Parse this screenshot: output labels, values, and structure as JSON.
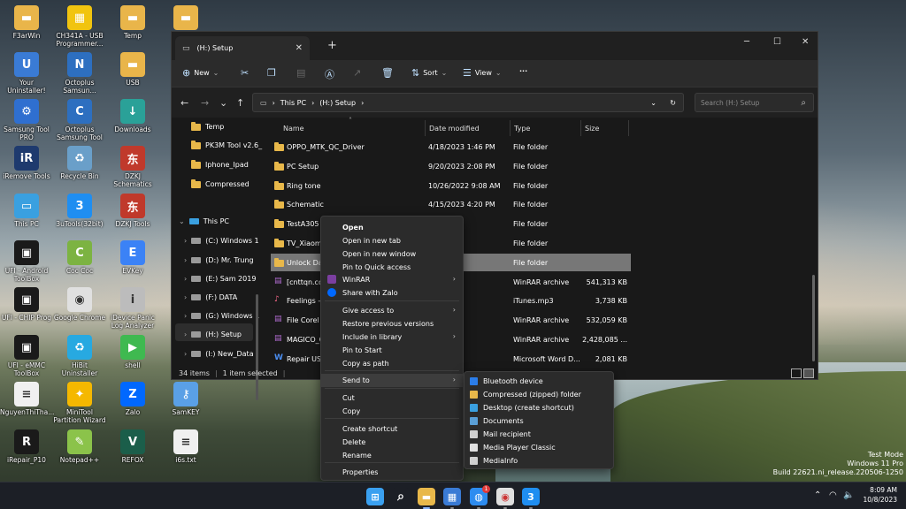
{
  "desktop": {
    "icons": [
      {
        "label": "F3arWin",
        "color": "#e9b54a",
        "glyph": "▬"
      },
      {
        "label": "CH341A - USB Programmer...",
        "color": "#f1c40f",
        "glyph": "▦"
      },
      {
        "label": "Temp",
        "color": "#e9b54a",
        "glyph": "▬"
      },
      {
        "label": "",
        "color": "#e9b54a",
        "glyph": "▬"
      },
      {
        "label": "Your Uninstaller!",
        "color": "#3a7bd5",
        "glyph": "U"
      },
      {
        "label": "Octoplus Samsun...",
        "color": "#2d6fc0",
        "glyph": "N"
      },
      {
        "label": "USB",
        "color": "#e9b54a",
        "glyph": "▬"
      },
      {
        "label": "Samsung Tool PRO",
        "color": "#2f6fd0",
        "glyph": "⚙"
      },
      {
        "label": "Octoplus Samsung Tool",
        "color": "#2d6fc0",
        "glyph": "C"
      },
      {
        "label": "Downloads",
        "color": "#2aa198",
        "glyph": "↓"
      },
      {
        "label": "iRemove Tools",
        "color": "#1e3a6e",
        "glyph": "iR"
      },
      {
        "label": "Recycle Bin",
        "color": "#6a9fc9",
        "glyph": "♻"
      },
      {
        "label": "DZKJ Schematics",
        "color": "#c0392b",
        "glyph": "东"
      },
      {
        "label": "This PC",
        "color": "#3aa0e0",
        "glyph": "▭"
      },
      {
        "label": "3uTools(32bit)",
        "color": "#1f8ef1",
        "glyph": "3"
      },
      {
        "label": "DZKJ Tools",
        "color": "#c0392b",
        "glyph": "东"
      },
      {
        "label": "UFI - Android ToolBox",
        "color": "#1a1a1a",
        "glyph": "▣"
      },
      {
        "label": "Coc Coc",
        "color": "#7cb342",
        "glyph": "C"
      },
      {
        "label": "EVKey",
        "color": "#3b82f6",
        "glyph": "E"
      },
      {
        "label": "UFI - CHIP Prog",
        "color": "#1a1a1a",
        "glyph": "▣"
      },
      {
        "label": "Google Chrome",
        "color": "#e0e0e0",
        "glyph": "◉"
      },
      {
        "label": "iDevice Panic Log Analyzer",
        "color": "#bcbcbc",
        "glyph": "i"
      },
      {
        "label": "UFI - eMMC ToolBox",
        "color": "#1a1a1a",
        "glyph": "▣"
      },
      {
        "label": "HiBit Uninstaller",
        "color": "#27a9e1",
        "glyph": "♻"
      },
      {
        "label": "shell",
        "color": "#3fb950",
        "glyph": "▶"
      },
      {
        "label": "NguyenThiTha...",
        "color": "#f0f0f0",
        "glyph": "≡"
      },
      {
        "label": "MiniTool Partition Wizard",
        "color": "#f5b800",
        "glyph": "✦"
      },
      {
        "label": "Zalo",
        "color": "#0068ff",
        "glyph": "Z"
      },
      {
        "label": "SamKEY",
        "color": "#5aa0e6",
        "glyph": "⚷"
      },
      {
        "label": "iRepair_P10",
        "color": "#1a1a1a",
        "glyph": "R"
      },
      {
        "label": "Notepad++",
        "color": "#8bc34a",
        "glyph": "✎"
      },
      {
        "label": "REFOX",
        "color": "#1b5e4a",
        "glyph": "V"
      },
      {
        "label": "i6s.txt",
        "color": "#f0f0f0",
        "glyph": "≡"
      }
    ]
  },
  "explorer": {
    "tab_title": "(H:) Setup",
    "toolbar": {
      "new": "New",
      "sort": "Sort",
      "view": "View",
      "more": "···"
    },
    "breadcrumb": [
      "This PC",
      "(H:) Setup"
    ],
    "search_placeholder": "Search (H:) Setup",
    "nav": [
      {
        "label": "Temp",
        "kind": "folder"
      },
      {
        "label": "PK3M Tool v2.6_",
        "kind": "folder"
      },
      {
        "label": "Iphone_Ipad",
        "kind": "folder"
      },
      {
        "label": "Compressed",
        "kind": "folder"
      },
      {
        "label": "This PC",
        "kind": "pc"
      },
      {
        "label": "(C:) Windows 1",
        "kind": "drive"
      },
      {
        "label": "(D:) Mr. Trung",
        "kind": "drive"
      },
      {
        "label": "(E:) Sam 2019",
        "kind": "drive"
      },
      {
        "label": "(F:) DATA",
        "kind": "drive"
      },
      {
        "label": "(G:) Windows 1",
        "kind": "drive"
      },
      {
        "label": "(H:) Setup",
        "kind": "drive"
      },
      {
        "label": "(I:) New_Data",
        "kind": "drive"
      }
    ],
    "columns": {
      "name": "Name",
      "date": "Date modified",
      "type": "Type",
      "size": "Size"
    },
    "rows": [
      {
        "name": "OPPO_MTK_QC_Driver",
        "date": "4/18/2023 1:46 PM",
        "type": "File folder",
        "size": "",
        "icon": "folder"
      },
      {
        "name": "PC Setup",
        "date": "9/20/2023 2:08 PM",
        "type": "File folder",
        "size": "",
        "icon": "folder"
      },
      {
        "name": "Ring tone",
        "date": "10/26/2022 9:08 AM",
        "type": "File folder",
        "size": "",
        "icon": "folder"
      },
      {
        "name": "Schematic",
        "date": "4/15/2023 4:20 PM",
        "type": "File folder",
        "size": "",
        "icon": "folder"
      },
      {
        "name": "TestA305",
        "date": "9:09 AM",
        "type": "File folder",
        "size": "",
        "icon": "folder"
      },
      {
        "name": "TV_Xiaomi",
        "date": "12:25 PM",
        "type": "File folder",
        "size": "",
        "icon": "folder"
      },
      {
        "name": "Unlock Da",
        "date": "9:09 AM",
        "type": "File folder",
        "size": "",
        "icon": "folder"
      },
      {
        "name": "[cnttqn.co",
        "date": "4:10 PM",
        "type": "WinRAR archive",
        "size": "541,313 KB",
        "icon": "rar"
      },
      {
        "name": "Feelings -",
        "date": "4:23 PM",
        "type": "iTunes.mp3",
        "size": "3,738 KB",
        "icon": "audio"
      },
      {
        "name": "File Corel X",
        "date": "10:55 AM",
        "type": "WinRAR archive",
        "size": "532,059 KB",
        "icon": "rar"
      },
      {
        "name": "MAGICO_C",
        "date": "12:41 PM",
        "type": "WinRAR archive",
        "size": "2,428,085 ...",
        "icon": "rar"
      },
      {
        "name": "Repair USE",
        "date": "11:27 AM",
        "type": "Microsoft Word D...",
        "size": "2,081 KB",
        "icon": "word"
      }
    ],
    "status": {
      "count": "34 items",
      "selected": "1 item selected"
    }
  },
  "context_menu": {
    "items": [
      {
        "label": "Open",
        "bold": true,
        "submenu": false,
        "icon": ""
      },
      {
        "label": "Open in new tab",
        "bold": false,
        "submenu": false,
        "icon": ""
      },
      {
        "label": "Open in new window",
        "bold": false,
        "submenu": false,
        "icon": ""
      },
      {
        "label": "Pin to Quick access",
        "bold": false,
        "submenu": false,
        "icon": ""
      },
      {
        "label": "WinRAR",
        "bold": false,
        "submenu": true,
        "icon": "winrar-icon"
      },
      {
        "label": "Share with Zalo",
        "bold": false,
        "submenu": false,
        "icon": "zalo-icon"
      },
      {
        "label": "Give access to",
        "bold": false,
        "submenu": true,
        "icon": ""
      },
      {
        "label": "Restore previous versions",
        "bold": false,
        "submenu": false,
        "icon": ""
      },
      {
        "label": "Include in library",
        "bold": false,
        "submenu": true,
        "icon": ""
      },
      {
        "label": "Pin to Start",
        "bold": false,
        "submenu": false,
        "icon": ""
      },
      {
        "label": "Copy as path",
        "bold": false,
        "submenu": false,
        "icon": ""
      },
      {
        "label": "Send to",
        "bold": false,
        "submenu": true,
        "icon": ""
      },
      {
        "label": "Cut",
        "bold": false,
        "submenu": false,
        "icon": ""
      },
      {
        "label": "Copy",
        "bold": false,
        "submenu": false,
        "icon": ""
      },
      {
        "label": "Create shortcut",
        "bold": false,
        "submenu": false,
        "icon": ""
      },
      {
        "label": "Delete",
        "bold": false,
        "submenu": false,
        "icon": ""
      },
      {
        "label": "Rename",
        "bold": false,
        "submenu": false,
        "icon": ""
      },
      {
        "label": "Properties",
        "bold": false,
        "submenu": false,
        "icon": ""
      }
    ],
    "send_to": [
      {
        "label": "Bluetooth device",
        "icon": "bluetooth-icon",
        "color": "#2b7de9"
      },
      {
        "label": "Compressed (zipped) folder",
        "icon": "zip-folder-icon",
        "color": "#e8b84a"
      },
      {
        "label": "Desktop (create shortcut)",
        "icon": "desktop-icon",
        "color": "#3aa0e0"
      },
      {
        "label": "Documents",
        "icon": "documents-icon",
        "color": "#5a9fd6"
      },
      {
        "label": "Mail recipient",
        "icon": "mail-icon",
        "color": "#d0d0d0"
      },
      {
        "label": "Media Player Classic",
        "icon": "media-player-icon",
        "color": "#e0e0e0"
      },
      {
        "label": "MediaInfo",
        "icon": "mediainfo-icon",
        "color": "#d0d0d0"
      }
    ]
  },
  "taskbar": {
    "apps": [
      {
        "name": "start-button",
        "color": "#3aa0f0",
        "glyph": "⊞"
      },
      {
        "name": "search-button",
        "color": "#1c1f26",
        "glyph": "⌕"
      },
      {
        "name": "file-explorer-app",
        "color": "#e8b84a",
        "glyph": "▬"
      },
      {
        "name": "store-app",
        "color": "#3a7bd5",
        "glyph": "▦"
      },
      {
        "name": "messenger-app",
        "color": "#2d8cf0",
        "glyph": "◍"
      },
      {
        "name": "chrome-app",
        "color": "#e0e0e0",
        "glyph": "◉"
      },
      {
        "name": "3utools-app",
        "color": "#1f8ef1",
        "glyph": "3"
      }
    ],
    "badge": "1",
    "time": "8:09 AM",
    "date": "10/8/2023"
  },
  "watermark": {
    "line1": "Test Mode",
    "line2": "Windows 11 Pro",
    "line3": "Build 22621.ni_release.220506-1250"
  }
}
